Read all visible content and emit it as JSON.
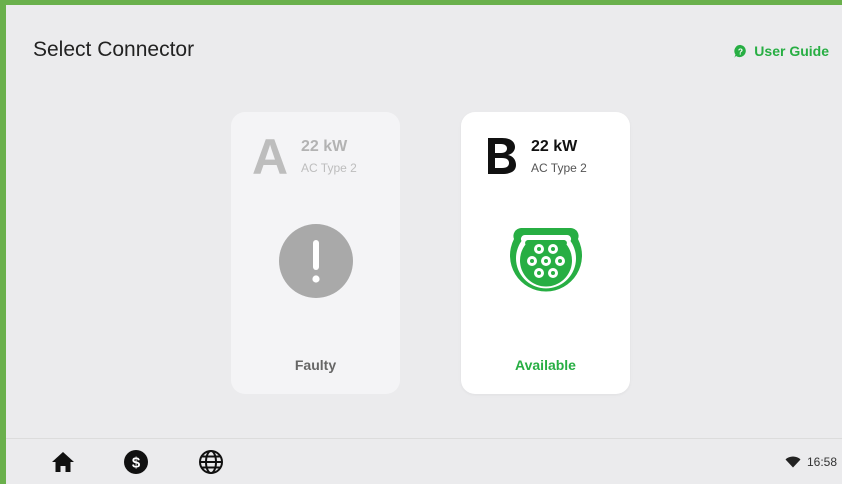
{
  "header": {
    "title": "Select Connector",
    "user_guide_label": "User Guide",
    "user_guide_icon": "help-bubble-icon"
  },
  "connectors": [
    {
      "letter": "A",
      "power": "22 kW",
      "type": "AC Type 2",
      "status": "Faulty",
      "status_icon": "warning-icon"
    },
    {
      "letter": "B",
      "power": "22 kW",
      "type": "AC Type 2",
      "status": "Available",
      "status_icon": "type2-plug-icon"
    }
  ],
  "bottom_bar": {
    "nav": [
      "home-icon",
      "billing-icon",
      "language-globe-icon"
    ],
    "wifi_icon": "wifi-icon",
    "time": "16:58"
  },
  "colors": {
    "accent_green": "#27ae43",
    "frame_green": "#6ab04c",
    "faulty_grey": "#a9a9a9"
  }
}
